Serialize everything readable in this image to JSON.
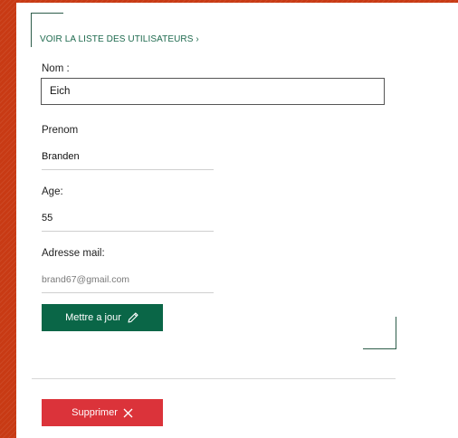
{
  "nav": {
    "back_link": "VOIR LA LISTE DES UTILISATEURS ›"
  },
  "form": {
    "nom_label": "Nom :",
    "nom_value": "Eich",
    "prenom_label": "Prenom",
    "prenom_value": "Branden",
    "age_label": "Age:",
    "age_value": "55",
    "email_label": "Adresse mail:",
    "email_value": "brand67@gmail.com"
  },
  "actions": {
    "update_label": "Mettre a jour",
    "update_icon": "pencil-icon",
    "delete_label": "Supprimer",
    "delete_icon": "close-icon"
  },
  "colors": {
    "background": "#c83a14",
    "accent_green": "#0a6647",
    "link_green": "#1e6a4e",
    "danger_red": "#db333a"
  }
}
